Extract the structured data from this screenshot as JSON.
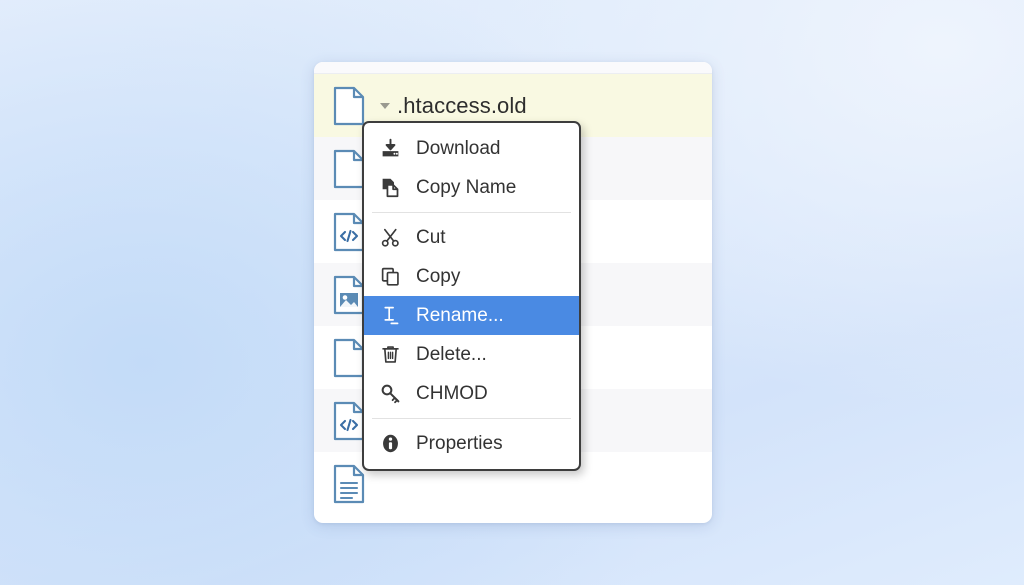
{
  "background": {
    "gradient_from": "#e6effc",
    "gradient_mid": "#c3dbf8",
    "gradient_to": "#dfecfd"
  },
  "file_panel": {
    "selected_row_color": "#f9f9e2",
    "stripe_color": "#f7f7f9",
    "rows": [
      {
        "icon": "file-blank-icon",
        "name": ".htaccess.old",
        "selected": true,
        "has_caret": true
      },
      {
        "icon": "file-blank-icon",
        "name": "",
        "selected": false,
        "has_caret": false
      },
      {
        "icon": "file-code-icon",
        "name": "",
        "selected": false,
        "has_caret": false
      },
      {
        "icon": "file-image-icon",
        "name": "",
        "selected": false,
        "has_caret": false
      },
      {
        "icon": "file-blank-icon",
        "name": "",
        "selected": false,
        "has_caret": false
      },
      {
        "icon": "file-code-icon",
        "name": "",
        "selected": false,
        "has_caret": false
      },
      {
        "icon": "file-document-icon",
        "name": "",
        "selected": false,
        "has_caret": false
      }
    ]
  },
  "context_menu": {
    "highlight_color": "#4a8ae3",
    "border_color": "#3d3d3d",
    "items": [
      {
        "id": "download",
        "label": "Download",
        "icon": "download-icon",
        "active": false,
        "separator_after": false
      },
      {
        "id": "copy-name",
        "label": "Copy Name",
        "icon": "copy-name-icon",
        "active": false,
        "separator_after": true
      },
      {
        "id": "cut",
        "label": "Cut",
        "icon": "scissors-icon",
        "active": false,
        "separator_after": false
      },
      {
        "id": "copy",
        "label": "Copy",
        "icon": "copy-icon",
        "active": false,
        "separator_after": false
      },
      {
        "id": "rename",
        "label": "Rename...",
        "icon": "i-beam-icon",
        "active": true,
        "separator_after": false
      },
      {
        "id": "delete",
        "label": "Delete...",
        "icon": "trash-icon",
        "active": false,
        "separator_after": false
      },
      {
        "id": "chmod",
        "label": "CHMOD",
        "icon": "key-icon",
        "active": false,
        "separator_after": true
      },
      {
        "id": "properties",
        "label": "Properties",
        "icon": "info-icon",
        "active": false,
        "separator_after": false
      }
    ]
  }
}
